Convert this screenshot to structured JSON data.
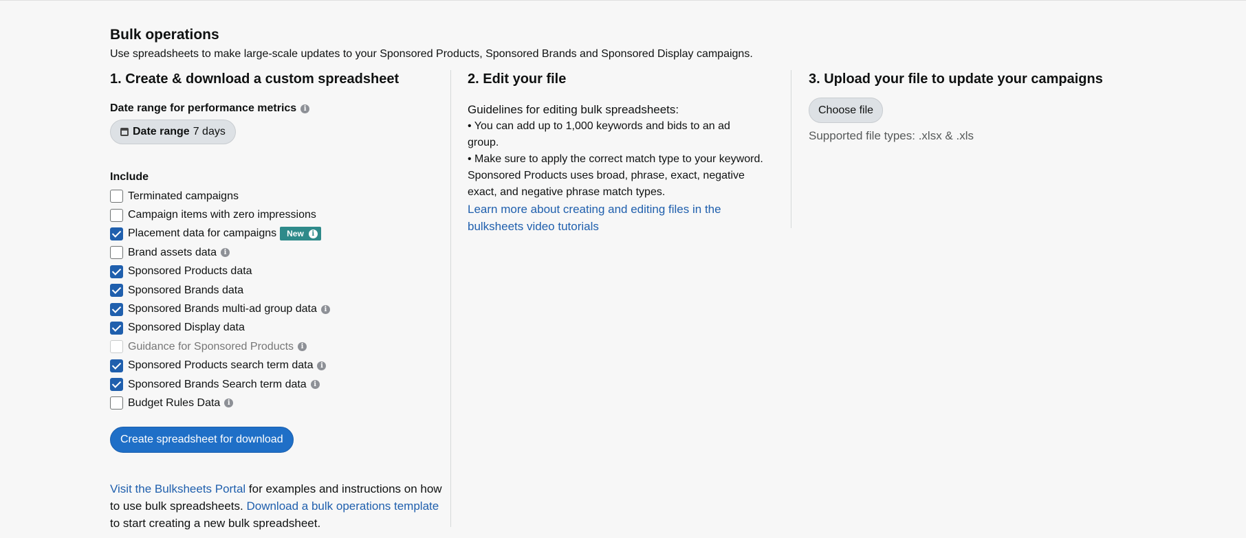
{
  "header": {
    "title": "Bulk operations",
    "subtitle": "Use spreadsheets to make large-scale updates to your Sponsored Products, Sponsored Brands and Sponsored Display campaigns."
  },
  "step1": {
    "title": "1. Create & download a custom spreadsheet",
    "date_range_label": "Date range for performance metrics",
    "date_button_label": "Date range",
    "date_button_value": "7 days",
    "include_label": "Include",
    "options": [
      {
        "label": "Terminated campaigns",
        "checked": false,
        "info": false,
        "disabled": false
      },
      {
        "label": "Campaign items with zero impressions",
        "checked": false,
        "info": false,
        "disabled": false
      },
      {
        "label": "Placement data for campaigns",
        "checked": true,
        "info": false,
        "disabled": false,
        "badge": "New"
      },
      {
        "label": "Brand assets data",
        "checked": false,
        "info": true,
        "disabled": false
      },
      {
        "label": "Sponsored Products data",
        "checked": true,
        "info": false,
        "disabled": false
      },
      {
        "label": "Sponsored Brands data",
        "checked": true,
        "info": false,
        "disabled": false
      },
      {
        "label": "Sponsored Brands multi-ad group data",
        "checked": true,
        "info": true,
        "disabled": false
      },
      {
        "label": "Sponsored Display data",
        "checked": true,
        "info": false,
        "disabled": false
      },
      {
        "label": "Guidance for Sponsored Products",
        "checked": false,
        "info": true,
        "disabled": true
      },
      {
        "label": "Sponsored Products search term data",
        "checked": true,
        "info": true,
        "disabled": false
      },
      {
        "label": "Sponsored Brands Search term data",
        "checked": true,
        "info": true,
        "disabled": false
      },
      {
        "label": "Budget Rules Data",
        "checked": false,
        "info": true,
        "disabled": false
      }
    ],
    "create_button": "Create spreadsheet for download",
    "footer": {
      "portal_link": "Visit the Bulksheets Portal",
      "text1": " for examples and instructions on how to use bulk spreadsheets. ",
      "template_link": "Download a bulk operations template",
      "text2": " to start creating a new bulk spreadsheet."
    }
  },
  "step2": {
    "title": "2. Edit your file",
    "guidelines_title": "Guidelines for editing bulk spreadsheets:",
    "guidelines": [
      "• You can add up to 1,000 keywords and bids to an ad group.",
      "• Make sure to apply the correct match type to your keyword. Sponsored Products uses broad, phrase, exact, negative exact, and negative phrase match types."
    ],
    "learn_link": "Learn more about creating and editing files in the bulksheets video tutorials"
  },
  "step3": {
    "title": "3. Upload your file to update your campaigns",
    "choose_button": "Choose file",
    "file_types": "Supported file types: .xlsx & .xls"
  },
  "icons": {
    "info": "info-icon",
    "calendar": "calendar-icon",
    "check": "checkmark-icon"
  },
  "colors": {
    "primary": "#1f6fc7",
    "link": "#1f5fad",
    "checkbox_checked": "#1f5fad",
    "badge": "#2e8a8a"
  }
}
